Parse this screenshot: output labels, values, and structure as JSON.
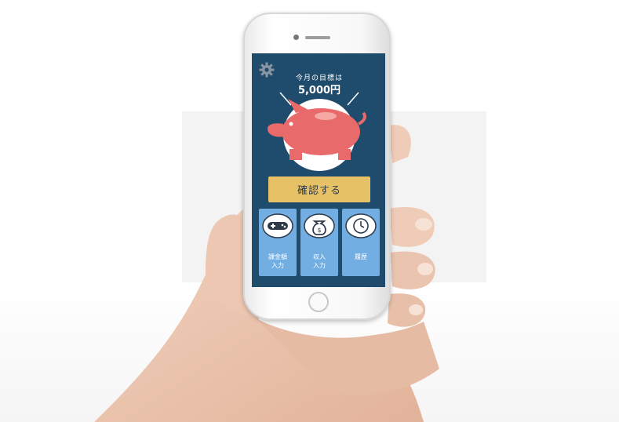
{
  "screen": {
    "goal_label": "今月の目標は",
    "goal_value": "5,000円",
    "confirm_button": "確認する",
    "menu": [
      {
        "label": "課金額\n入力",
        "icon": "gamepad-icon"
      },
      {
        "label": "収入\n入力",
        "icon": "money-bag-icon"
      },
      {
        "label": "履歴",
        "icon": "clock-icon"
      }
    ]
  },
  "colors": {
    "screen_bg": "#1f4c6d",
    "piggy": "#e86a6a",
    "confirm": "#e6c165",
    "menu_tile": "#73aee3"
  }
}
